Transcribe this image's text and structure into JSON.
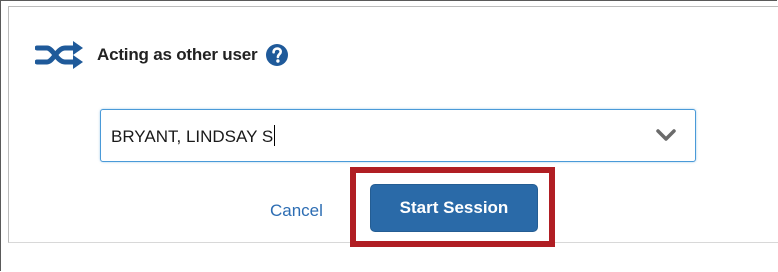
{
  "dialog": {
    "title": "Acting as other user",
    "icons": {
      "title_icon": "shuffle-icon",
      "help_icon": "question-circle-icon",
      "dropdown_icon": "chevron-down-icon"
    },
    "user_select": {
      "value": "BRYANT, LINDSAY S"
    },
    "cancel_label": "Cancel",
    "start_label": "Start Session"
  },
  "colors": {
    "accent": "#2a6aa8",
    "link": "#2d6db3",
    "highlight": "#b01e23",
    "icon": "#1f5a9a"
  }
}
